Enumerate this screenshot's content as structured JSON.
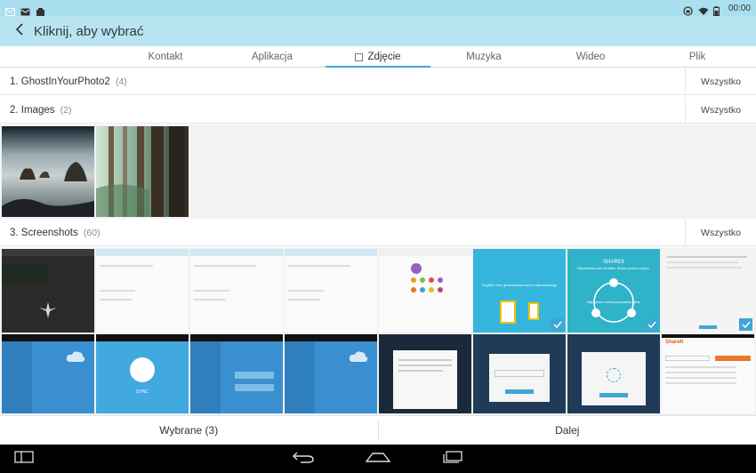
{
  "status_bar": {
    "time": "00:00"
  },
  "header": {
    "title": "Kliknij, aby wybrać"
  },
  "tabs": [
    {
      "label": "Kontakt"
    },
    {
      "label": "Aplikacja"
    },
    {
      "label": "Zdjęcie"
    },
    {
      "label": "Muzyka"
    },
    {
      "label": "Wideo"
    },
    {
      "label": "Plik"
    }
  ],
  "active_tab": "Zdjęcie",
  "groups": [
    {
      "title": "1. GhostInYourPhoto2",
      "count": "(4)",
      "all_label": "Wszystko"
    },
    {
      "title": "2. Images",
      "count": "(2)",
      "all_label": "Wszystko"
    },
    {
      "title": "3. Screenshots",
      "count": "(60)",
      "all_label": "Wszystko"
    }
  ],
  "screenshot_texts": {
    "shareit_title": "SHAREit",
    "shareit_caption": "Niepotrzebna sieć ani kable. Bardzo prosty w użyciu.",
    "shareit_connect": "Najszybsza metoda przesyłania plików",
    "shareit_share_msg": "Szybko i bez generowania ruchu internetowego",
    "sync_label": "SYNC",
    "web_logo": "ShareIt"
  },
  "actions": {
    "selected_label": "Wybrane (3)",
    "next_label": "Dalej"
  },
  "colors": {
    "accent": "#3fa6d6",
    "title_bar": "#b8e4f1",
    "status_bar": "#a9dfee"
  }
}
